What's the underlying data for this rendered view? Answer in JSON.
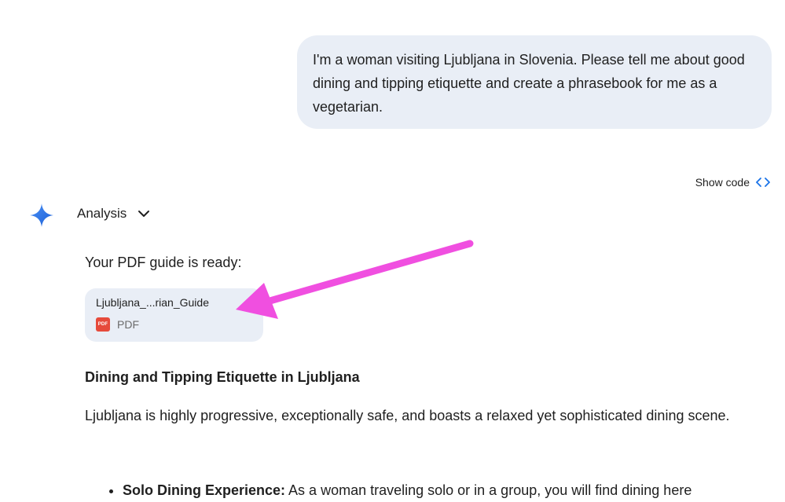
{
  "user_prompt": {
    "text": "I'm a woman visiting Ljubljana in Slovenia. Please tell me about good dining and tipping etiquette and create a phrasebook for me as a vegetarian."
  },
  "response": {
    "show_code_label": "Show code",
    "analysis_label": "Analysis",
    "ready_text": "Your PDF guide is ready:",
    "file": {
      "name": "Ljubljana_...rian_Guide",
      "type": "PDF",
      "badge": "PDF"
    },
    "section_heading": "Dining and Tipping Etiquette in Ljubljana",
    "intro_paragraph": "Ljubljana is highly progressive, exceptionally safe, and boasts a relaxed yet sophisticated dining scene.",
    "bullets": [
      {
        "title": "Solo Dining Experience:",
        "text": " As a woman traveling solo or in a group, you will find dining here"
      }
    ]
  },
  "colors": {
    "bubble": "#e9eef6",
    "annotation_arrow": "#f04fe0",
    "pdf_badge": "#e64a3b"
  }
}
